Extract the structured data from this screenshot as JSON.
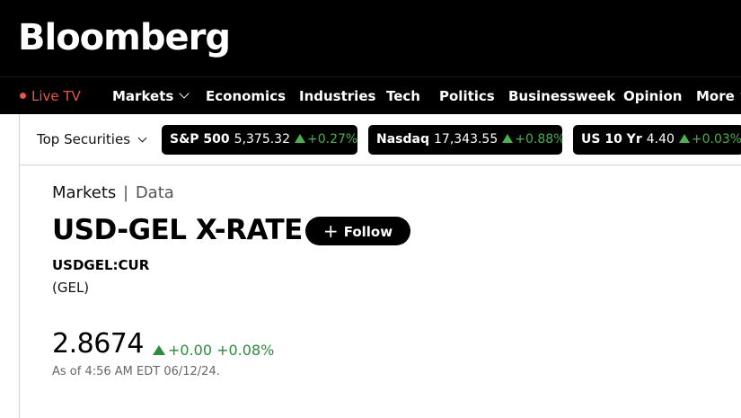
{
  "header": {
    "logo": "Bloomberg"
  },
  "nav": {
    "live_tv": "Live TV",
    "items": [
      {
        "label": "Markets"
      },
      {
        "label": "Economics"
      },
      {
        "label": "Industries"
      },
      {
        "label": "Tech"
      },
      {
        "label": "Politics"
      },
      {
        "label": "Businessweek"
      },
      {
        "label": "Opinion"
      },
      {
        "label": "More"
      }
    ],
    "live_color": "#e8554a"
  },
  "securities": {
    "label": "Top Securities",
    "items": [
      {
        "name": "S&P 500",
        "value": "5,375.32",
        "change": "+0.27%"
      },
      {
        "name": "Nasdaq",
        "value": "17,343.55",
        "change": "+0.88%"
      },
      {
        "name": "US 10 Yr",
        "value": "4.40",
        "change": "+0.03%"
      }
    ],
    "up_color": "#4caf50"
  },
  "quote": {
    "breadcrumb": {
      "section": "Markets",
      "separator": "|",
      "page": "Data"
    },
    "title": "USD-GEL X-RATE",
    "follow_label": "Follow",
    "ticker": "USDGEL:CUR",
    "currency": "(GEL)",
    "price": "2.8674",
    "change_abs": "+0.00",
    "change_pct": "+0.08%",
    "as_of": "As of 4:56 AM EDT 06/12/24.",
    "up_color": "#2e8b3d"
  }
}
